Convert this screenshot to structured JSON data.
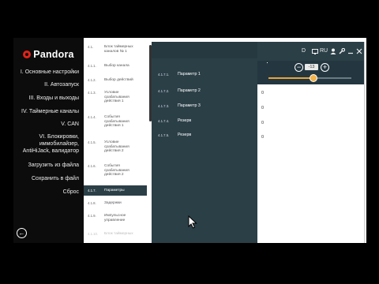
{
  "app": {
    "logo_text": "Pandora",
    "nav_items": [
      "I. Основные настройки",
      "II. Автозапуск",
      "III. Входы и выходы",
      "IV. Таймерные каналы",
      "V. CAN",
      "VI. Блокировки,",
      "иммобилайзер,",
      "AntiHiJack, валидатор",
      "Загрузить из файла",
      "Сохранить в файл",
      "Сброс"
    ],
    "back_label": "←"
  },
  "list": {
    "items": [
      {
        "num": "4.1.",
        "text": "Блок таймерных каналов № 1"
      },
      {
        "num": "4.1.1.",
        "text": "Выбор канала"
      },
      {
        "num": "4.1.2.",
        "text": "Выбор действий"
      },
      {
        "num": "4.1.3.",
        "text": "Условие срабатывания действия 1"
      },
      {
        "num": "4.1.4.",
        "text": "События срабатывания действия 1"
      },
      {
        "num": "4.1.5.",
        "text": "Условие срабатывания действия 2"
      },
      {
        "num": "4.1.6.",
        "text": "События срабатывания действия 2"
      },
      {
        "num": "4.1.7.",
        "text": "Параметры"
      },
      {
        "num": "4.1.8.",
        "text": "Задержки"
      },
      {
        "num": "4.1.9.",
        "text": "Импульсное управление"
      },
      {
        "num": "4.1.10.",
        "text": "Блок таймерных"
      }
    ]
  },
  "params": [
    {
      "num": "4.1.7.1.",
      "label": "Параметр 1",
      "value": "•"
    },
    {
      "num": "4.1.7.2.",
      "label": "Параметр 2",
      "value": "0"
    },
    {
      "num": "4.1.7.3.",
      "label": "Параметр 3",
      "value": "0"
    },
    {
      "num": "4.1.7.4.",
      "label": "Резерв",
      "value": "0"
    },
    {
      "num": "4.1.7.5.",
      "label": "Резерв",
      "value": "0"
    }
  ],
  "toolbar": {
    "d_label": "D",
    "lang_label": "RU"
  },
  "slider": {
    "value": "-13",
    "minus": "−",
    "plus": "+",
    "level": 0.53
  },
  "colors": {
    "accent": "#e32219",
    "panel": "#2b3f47",
    "slider": "#f3b24a"
  }
}
